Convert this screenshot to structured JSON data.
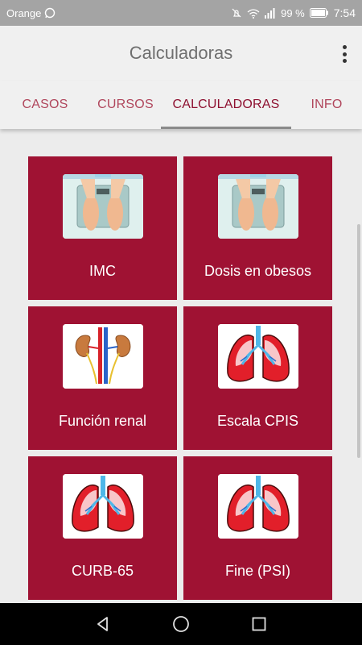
{
  "status_bar": {
    "carrier": "Orange",
    "battery_percent": "99 %",
    "time": "7:54"
  },
  "app_bar": {
    "title": "Calculadoras"
  },
  "tabs": [
    {
      "label": "CASOS",
      "active": false
    },
    {
      "label": "CURSOS",
      "active": false
    },
    {
      "label": "CALCULADORAS",
      "active": true
    },
    {
      "label": "INFO",
      "active": false
    }
  ],
  "calculators": [
    {
      "label": "IMC",
      "icon": "scale-icon"
    },
    {
      "label": "Dosis en obesos",
      "icon": "scale-icon"
    },
    {
      "label": "Función renal",
      "icon": "kidneys-icon"
    },
    {
      "label": "Escala CPIS",
      "icon": "lungs-icon"
    },
    {
      "label": "CURB-65",
      "icon": "lungs-icon"
    },
    {
      "label": "Fine (PSI)",
      "icon": "lungs-icon"
    }
  ],
  "colors": {
    "accent": "#9f1233",
    "tab_text": "#b0465c",
    "tab_active_text": "#8e1030",
    "status_bar": "#a4a4a4"
  }
}
